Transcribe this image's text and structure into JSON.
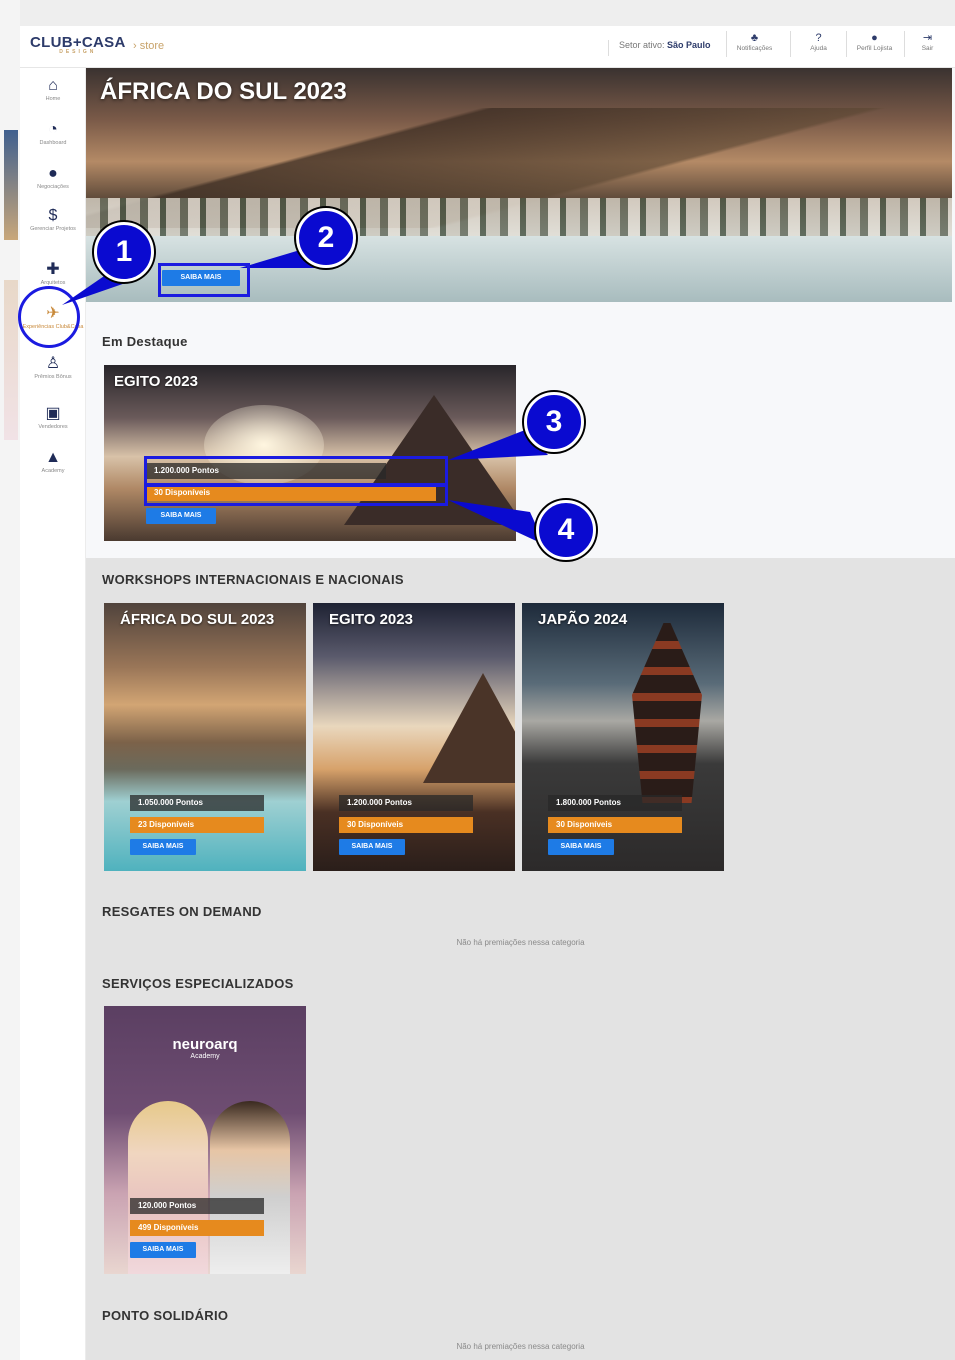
{
  "header": {
    "logo": "CLUB+CASA",
    "logo_sub": "DESIGN",
    "store": "› store",
    "sector_label": "Setor ativo:",
    "sector_value": "São Paulo",
    "nav": [
      {
        "icon": "bell-icon",
        "label": "Notificações"
      },
      {
        "icon": "help-icon",
        "label": "Ajuda"
      },
      {
        "icon": "user-icon",
        "label": "Perfil Lojista"
      },
      {
        "icon": "logout-icon",
        "label": "Sair"
      }
    ]
  },
  "sidebar": {
    "items": [
      {
        "icon": "home-icon",
        "label": "Home"
      },
      {
        "icon": "pie-chart-icon",
        "label": "Dashboard"
      },
      {
        "icon": "chat-icon",
        "label": "Negociações"
      },
      {
        "icon": "dollar-icon",
        "label": "Gerenciar Projetos"
      },
      {
        "icon": "users-icon",
        "label": "Arquitetos"
      },
      {
        "icon": "plane-icon",
        "label": "Experiências Club&Casa"
      },
      {
        "icon": "award-icon",
        "label": "Prêmios Bônus"
      },
      {
        "icon": "briefcase-icon",
        "label": "Vendedores"
      },
      {
        "icon": "graduation-icon",
        "label": "Academy"
      }
    ]
  },
  "hero": {
    "title": "ÁFRICA DO SUL 2023",
    "button": "SAIBA MAIS"
  },
  "featured": {
    "section_title": "Em Destaque",
    "title": "EGITO 2023",
    "points": "1.200.000 Pontos",
    "available": "30 Disponíveis",
    "button": "SAIBA MAIS"
  },
  "workshops": {
    "section_title": "WORKSHOPS INTERNACIONAIS E NACIONAIS",
    "cards": [
      {
        "title": "ÁFRICA DO SUL 2023",
        "points": "1.050.000 Pontos",
        "available": "23 Disponíveis",
        "button": "SAIBA MAIS"
      },
      {
        "title": "EGITO 2023",
        "points": "1.200.000 Pontos",
        "available": "30 Disponíveis",
        "button": "SAIBA MAIS"
      },
      {
        "title": "JAPÃO 2024",
        "points": "1.800.000 Pontos",
        "available": "30 Disponíveis",
        "button": "SAIBA MAIS"
      }
    ]
  },
  "on_demand": {
    "section_title": "RESGATES ON DEMAND",
    "empty": "Não há premiações nessa categoria"
  },
  "services": {
    "section_title": "SERVIÇOS ESPECIALIZADOS",
    "card": {
      "brand": "neuroarq",
      "brand_sub": "Academy",
      "points": "120.000 Pontos",
      "available": "499 Disponíveis",
      "button": "SAIBA MAIS"
    }
  },
  "solidario": {
    "section_title": "PONTO SOLIDÁRIO",
    "empty": "Não há premiações nessa categoria"
  },
  "annotations": [
    "1",
    "2",
    "3",
    "4"
  ],
  "colors": {
    "accent": "#1e7be6",
    "orange": "#e68a1e",
    "navy": "#1f2b57",
    "annotation": "#0a0ad0"
  }
}
